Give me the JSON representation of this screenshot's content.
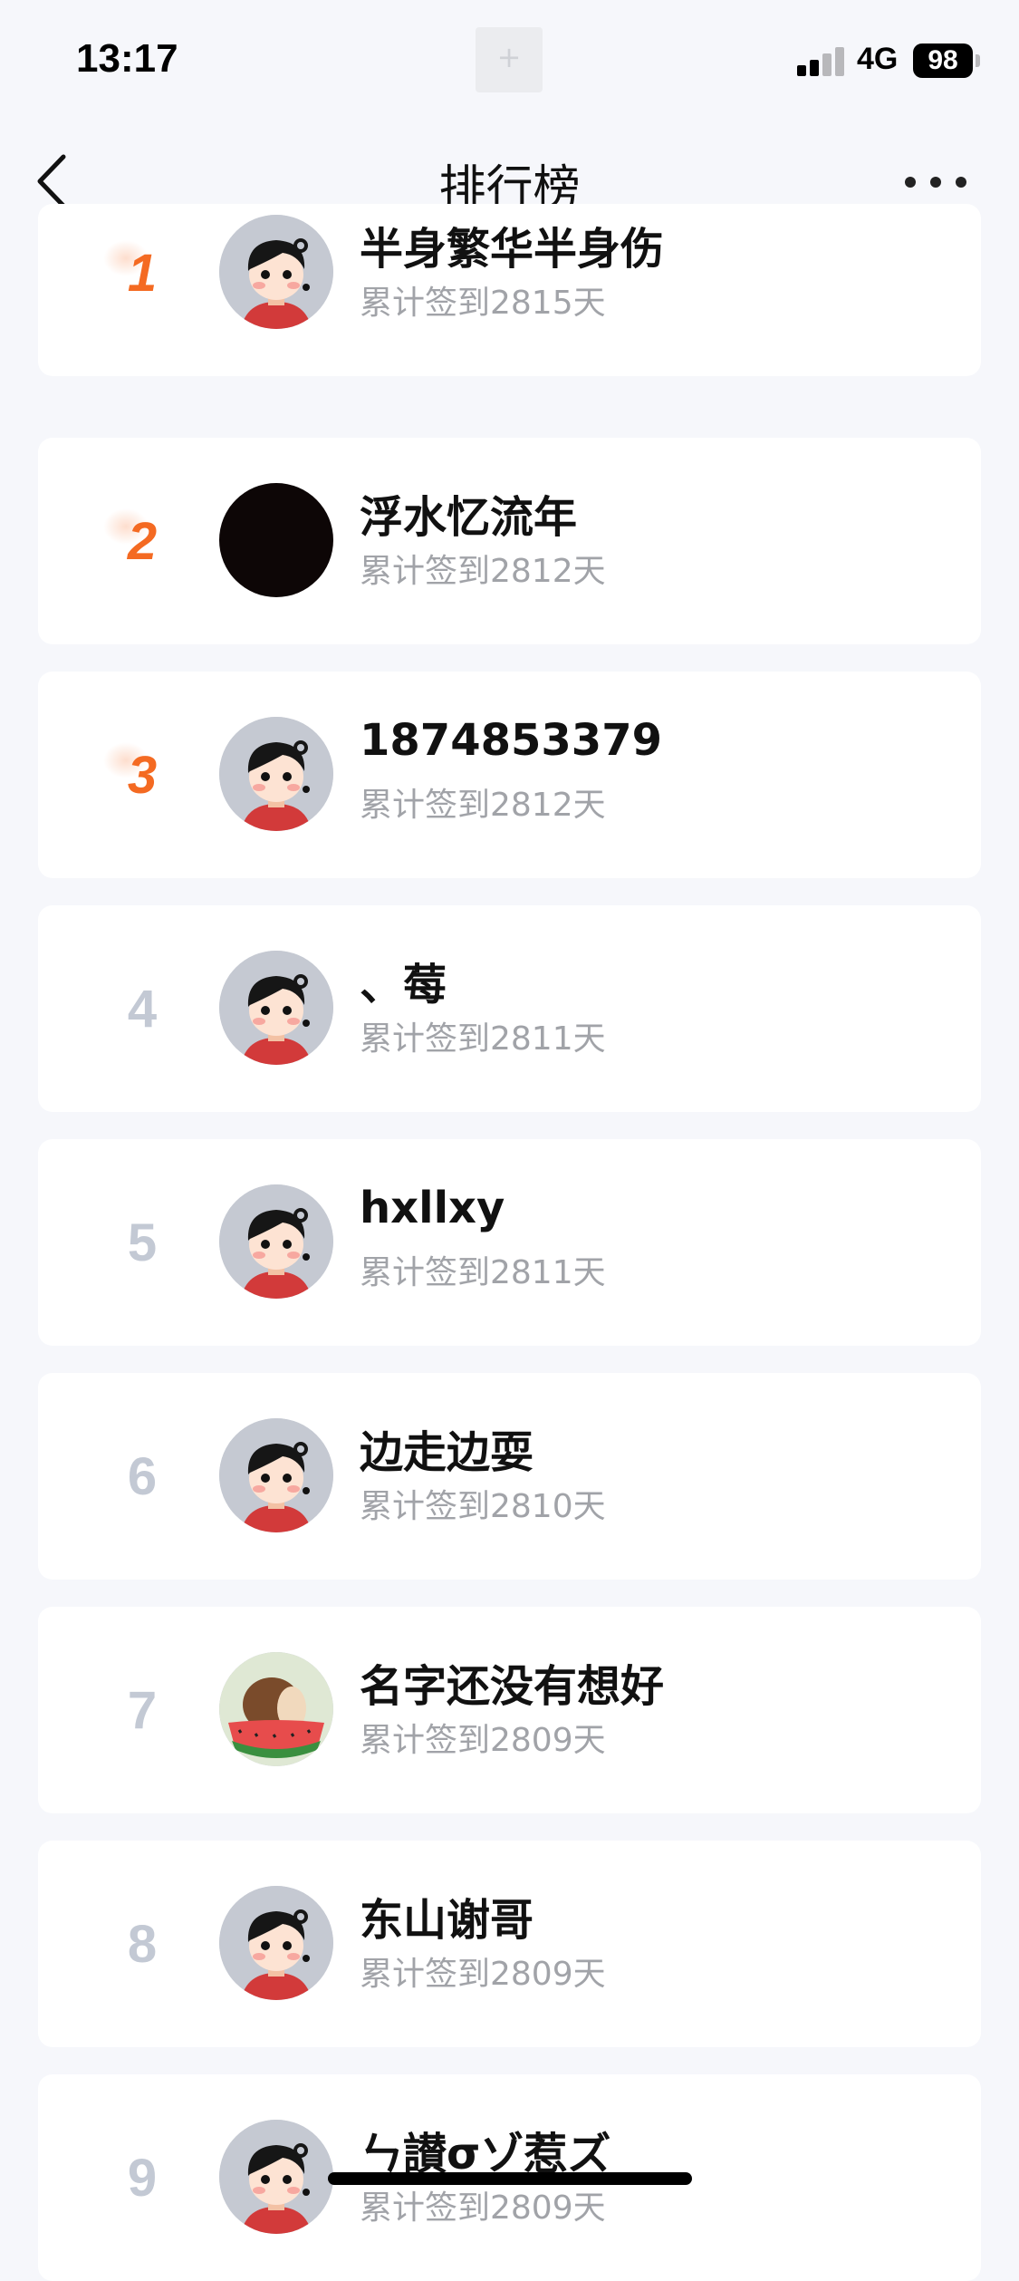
{
  "status_bar": {
    "time": "13:17",
    "notch_glyph": "+",
    "network": "4G",
    "battery": "98"
  },
  "nav": {
    "title": "排行榜",
    "back_icon": "chevron-left-icon",
    "more_icon": "more-dots-icon"
  },
  "ranking": [
    {
      "rank": "1",
      "name": "半身繁华半身伤",
      "days": "累计签到2815天",
      "avatar": "cartoon-boy"
    },
    {
      "rank": "2",
      "name": "浮水忆流年",
      "days": "累计签到2812天",
      "avatar": "black"
    },
    {
      "rank": "3",
      "name": "1874853379",
      "days": "累计签到2812天",
      "avatar": "cartoon-boy"
    },
    {
      "rank": "4",
      "name": "、莓",
      "days": "累计签到2811天",
      "avatar": "cartoon-boy"
    },
    {
      "rank": "5",
      "name": "hxllxy",
      "days": "累计签到2811天",
      "avatar": "cartoon-boy"
    },
    {
      "rank": "6",
      "name": "边走边耍",
      "days": "累计签到2810天",
      "avatar": "cartoon-boy"
    },
    {
      "rank": "7",
      "name": "名字还没有想好",
      "days": "累计签到2809天",
      "avatar": "watermelon-boy"
    },
    {
      "rank": "8",
      "name": "东山谢哥",
      "days": "累计签到2809天",
      "avatar": "cartoon-boy"
    },
    {
      "rank": "9",
      "name": "ㄣ讃σゾ惹ズ",
      "days": "累计签到2809天",
      "avatar": "cartoon-boy"
    }
  ],
  "colors": {
    "top_rank": "#f46a22",
    "rank": "#c3c9d4",
    "page_bg": "#f6f7fb",
    "card_bg": "#ffffff"
  }
}
